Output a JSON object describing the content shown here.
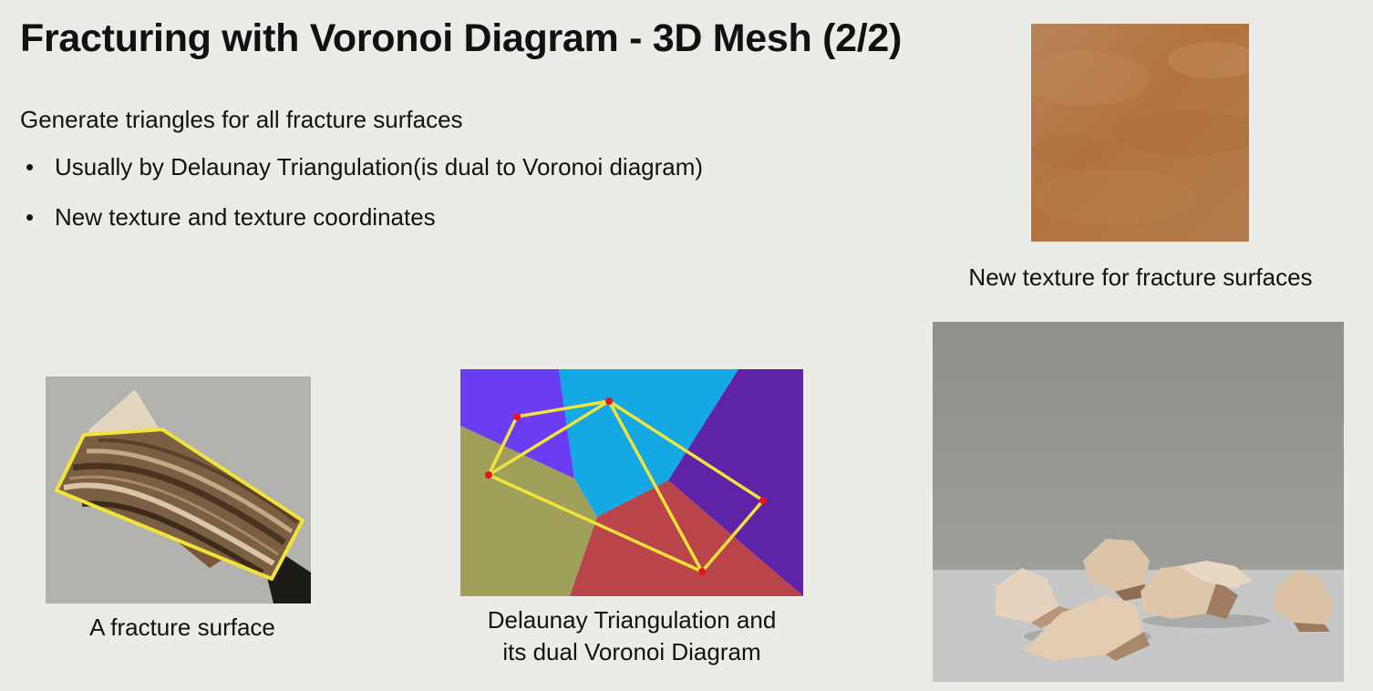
{
  "slide": {
    "title": "Fracturing with Voronoi Diagram - 3D Mesh (2/2)",
    "lead": "Generate triangles for all fracture surfaces",
    "bullet_marker": "•",
    "bullets": [
      "Usually by Delaunay Triangulation(is dual to Voronoi diagram)",
      "New texture and texture coordinates"
    ]
  },
  "captions": {
    "texture": "New texture for fracture surfaces",
    "fracture": "A fracture surface",
    "delaunay_line1": "Delaunay Triangulation and",
    "delaunay_line2": "its dual Voronoi Diagram"
  },
  "colors": {
    "background": "#ebebe8",
    "outline_yellow": "#f2e33a",
    "site_red": "#e8141c",
    "cell_blue_violet": "#6a3cf2",
    "cell_cyan": "#14a8e4",
    "cell_olive": "#9fa05a",
    "cell_red": "#b9444a",
    "cell_purple": "#5f23a8",
    "texture_brown": "#b37a45"
  }
}
